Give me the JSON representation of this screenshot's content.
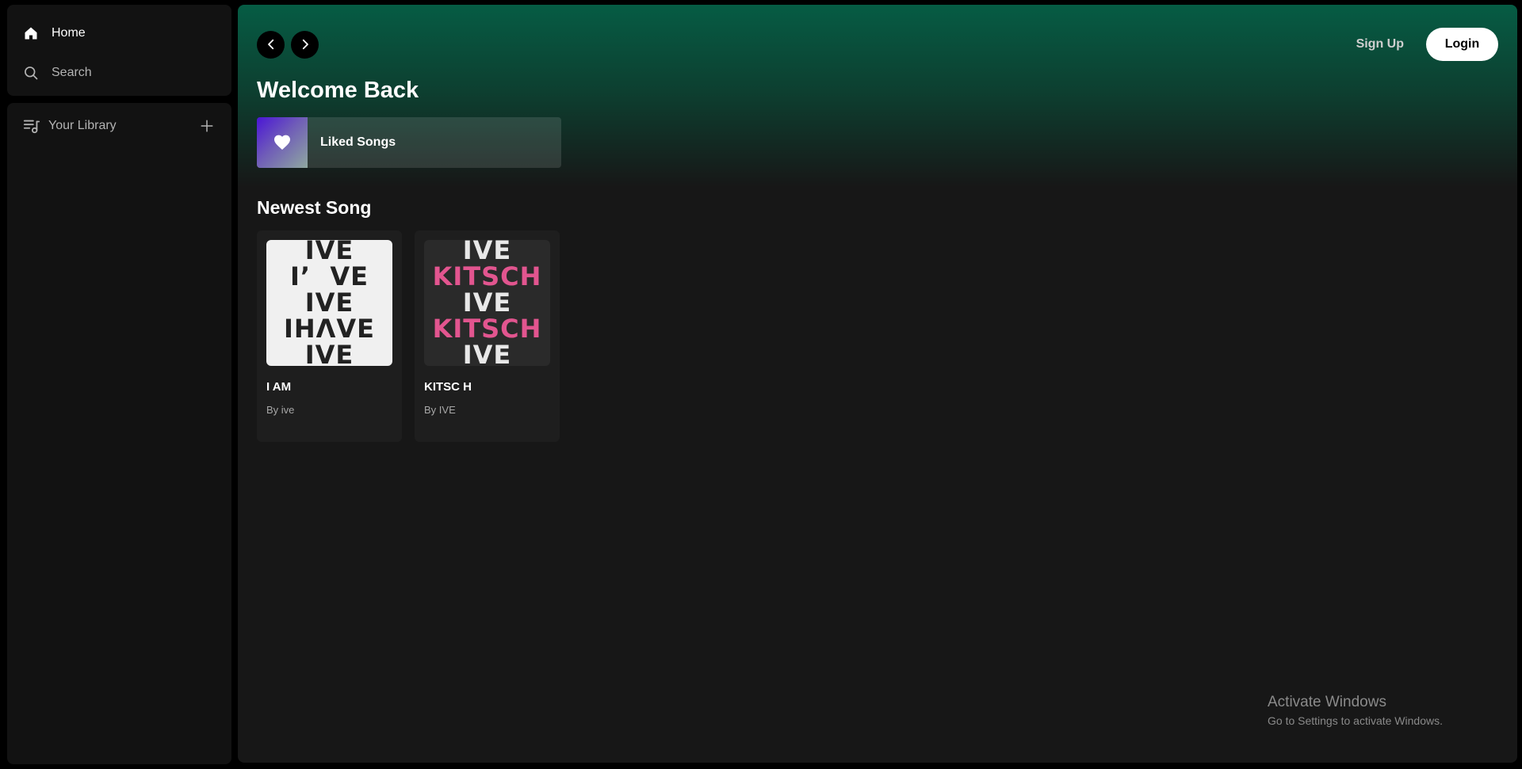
{
  "sidebar": {
    "nav": [
      {
        "label": "Home",
        "icon": "home-icon",
        "active": true
      },
      {
        "label": "Search",
        "icon": "search-icon",
        "active": false
      }
    ],
    "library": {
      "label": "Your Library",
      "add_icon": "plus-icon"
    }
  },
  "header": {
    "sign_up": "Sign Up",
    "login": "Login"
  },
  "main": {
    "welcome": "Welcome Back",
    "liked_songs": "Liked Songs",
    "section_title": "Newest Song",
    "songs": [
      {
        "title": "I AM",
        "author": "By ive",
        "cover_lines": [
          "IVE",
          "I’  VE",
          "IVE",
          "IHΛVE",
          "IVE"
        ]
      },
      {
        "title": "KITSC H",
        "author": "By IVE",
        "cover_lines": [
          "IVE",
          "KITSCH",
          "IVE",
          "KITSCH",
          "IVE"
        ]
      }
    ]
  },
  "watermark": {
    "line1": "Activate Windows",
    "line2": "Go to Settings to activate Windows."
  },
  "colors": {
    "accent_green": "#065c44",
    "liked_gradient_start": "#4a15d6",
    "pink": "#e2558f"
  }
}
